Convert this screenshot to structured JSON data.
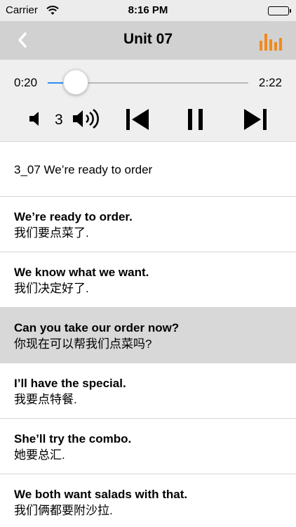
{
  "status": {
    "carrier": "Carrier",
    "time": "8:16 PM"
  },
  "nav": {
    "title": "Unit 07",
    "accent": "#f28a1a"
  },
  "player": {
    "elapsed": "0:20",
    "total": "2:22",
    "progress_fraction": 0.14,
    "volume_level": "3",
    "track_color": "#2a8df2"
  },
  "lesson": {
    "header": "3_07 We’re ready to order",
    "sentences": [
      {
        "en": "We’re ready to order.",
        "zh": "我们要点菜了."
      },
      {
        "en": "We know what we want.",
        "zh": "我们决定好了."
      },
      {
        "en": "Can you take our order now?",
        "zh": "你现在可以帮我们点菜吗?"
      },
      {
        "en": "I’ll have the special.",
        "zh": "我要点特餐."
      },
      {
        "en": "She’ll try the combo.",
        "zh": "她要总汇."
      },
      {
        "en": "We both want salads with that.",
        "zh": "我们俩都要附沙拉."
      }
    ],
    "selected_index": 2
  }
}
